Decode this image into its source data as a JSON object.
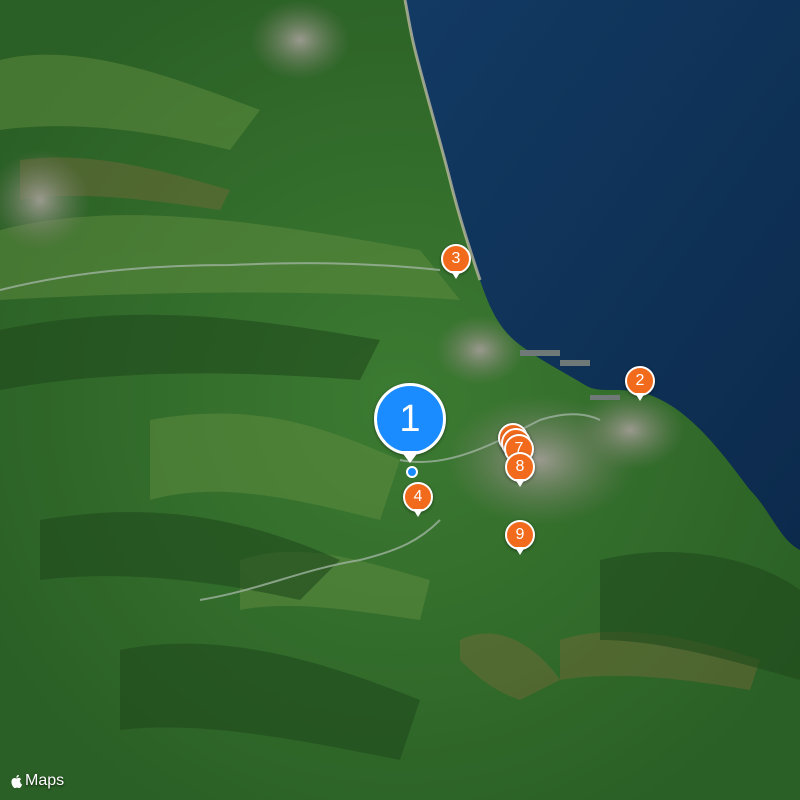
{
  "map": {
    "attribution": "Maps",
    "colors": {
      "sea": "#0f3156",
      "land": "#2f6a2a",
      "urban": "#8a8f86",
      "pin_orange": "#f26b1d",
      "pin_blue": "#1a8cff"
    },
    "selected_marker": {
      "label": "1",
      "color": "#1a8cff"
    },
    "markers": [
      {
        "label": "2"
      },
      {
        "label": "3"
      },
      {
        "label": "4"
      },
      {
        "label": "7"
      },
      {
        "label": "8"
      },
      {
        "label": "9"
      }
    ],
    "icons": {
      "logo": "apple-logo-icon",
      "location": "current-location-dot"
    }
  }
}
